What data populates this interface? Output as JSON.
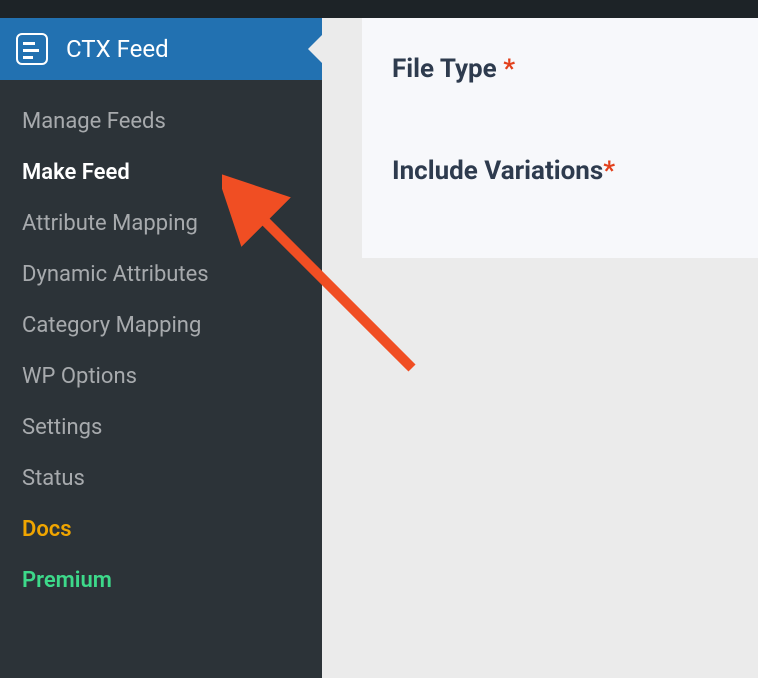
{
  "header": {
    "title": "CTX Feed"
  },
  "sidebar": {
    "items": [
      {
        "label": "Manage Feeds",
        "active": false
      },
      {
        "label": "Make Feed",
        "active": true
      },
      {
        "label": "Attribute Mapping",
        "active": false
      },
      {
        "label": "Dynamic Attributes",
        "active": false
      },
      {
        "label": "Category Mapping",
        "active": false
      },
      {
        "label": "WP Options",
        "active": false
      },
      {
        "label": "Settings",
        "active": false
      },
      {
        "label": "Status",
        "active": false
      },
      {
        "label": "Docs",
        "active": false,
        "style": "docs"
      },
      {
        "label": "Premium",
        "active": false,
        "style": "premium"
      }
    ]
  },
  "content": {
    "fields": [
      {
        "label": "File Type ",
        "required": "*"
      },
      {
        "label": "Include Variations",
        "required": "*"
      }
    ]
  }
}
